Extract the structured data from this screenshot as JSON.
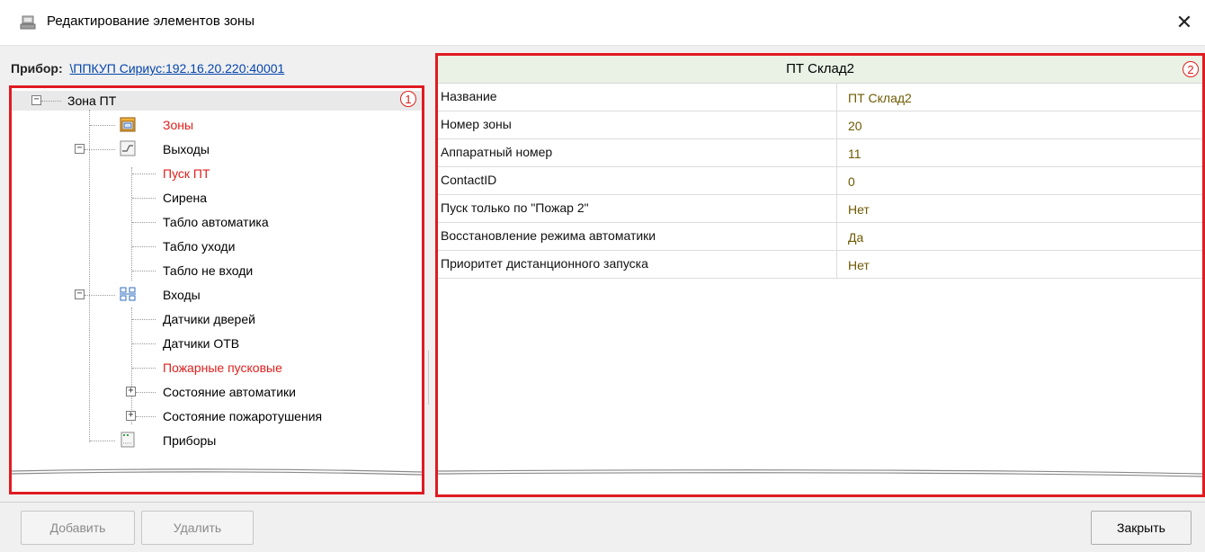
{
  "window": {
    "title": "Редактирование элементов зоны",
    "close_symbol": "✕"
  },
  "device": {
    "label": "Прибор:",
    "value": "\\ППКУП Сириус:192.16.20.220:40001"
  },
  "tree": {
    "root": "Зона ПТ",
    "items": [
      {
        "label": "Зоны",
        "highlight": true,
        "icon": "zones-icon"
      },
      {
        "label": "Выходы",
        "highlight": false,
        "icon": "outputs-icon"
      },
      {
        "label": "Пуск ПТ",
        "highlight": true
      },
      {
        "label": "Сирена",
        "highlight": false
      },
      {
        "label": "Табло автоматика",
        "highlight": false
      },
      {
        "label": "Табло уходи",
        "highlight": false
      },
      {
        "label": "Табло не входи",
        "highlight": false
      },
      {
        "label": "Входы",
        "highlight": false,
        "icon": "inputs-icon"
      },
      {
        "label": "Датчики дверей",
        "highlight": false
      },
      {
        "label": "Датчики ОТВ",
        "highlight": false
      },
      {
        "label": "Пожарные пусковые",
        "highlight": true
      },
      {
        "label": "Состояние автоматики",
        "highlight": false
      },
      {
        "label": "Состояние пожаротушения",
        "highlight": false
      },
      {
        "label": "Приборы",
        "highlight": false,
        "icon": "devices-icon"
      }
    ]
  },
  "badges": {
    "left": "1",
    "right": "2"
  },
  "properties": {
    "header": "ПТ Склад2",
    "rows": [
      {
        "name": "Название",
        "value": "ПТ Склад2"
      },
      {
        "name": "Номер зоны",
        "value": "20"
      },
      {
        "name": "Аппаратный номер",
        "value": "11"
      },
      {
        "name": "ContactID",
        "value": "0"
      },
      {
        "name": "Пуск только по \"Пожар 2\"",
        "value": "Нет"
      },
      {
        "name": "Восстановление режима автоматики",
        "value": "Да"
      },
      {
        "name": "Приоритет дистанционного запуска",
        "value": "Нет"
      }
    ]
  },
  "buttons": {
    "add": "Добавить",
    "delete": "Удалить",
    "close": "Закрыть"
  },
  "colors": {
    "accent_red": "#e01b22",
    "highlight_text": "#e0201d",
    "value_text": "#6e5a00"
  }
}
